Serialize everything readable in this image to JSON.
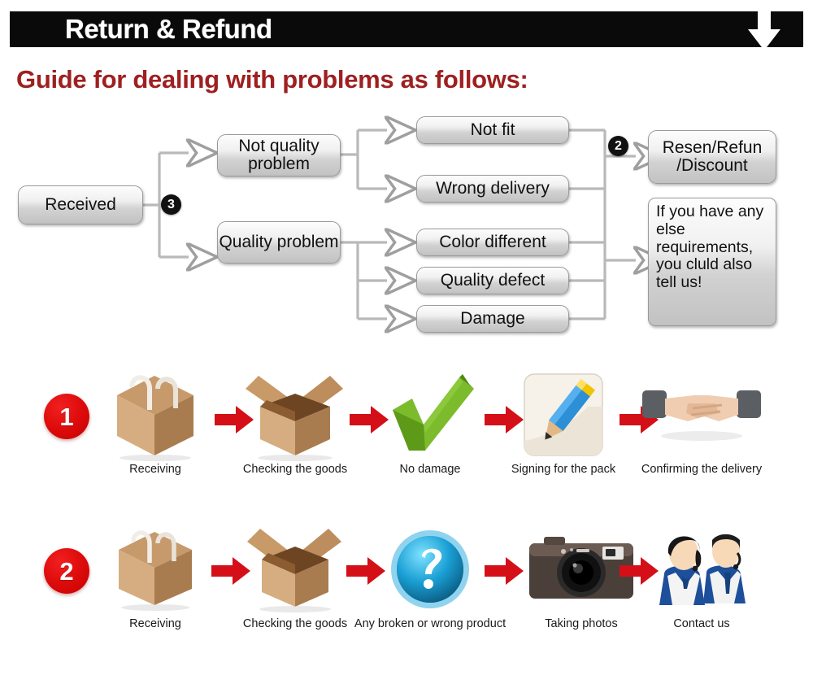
{
  "header": {
    "title": "Return & Refund",
    "arrow_icon": "down-arrow-icon"
  },
  "guide": {
    "title": "Guide for dealing with problems as follows:"
  },
  "colors": {
    "header_bg": "#0a0a0a",
    "header_text": "#ffffff",
    "guide_text": "#9e2020",
    "badge_bg": "#111111",
    "step_circle_red": "#e00d0d",
    "arrow_red": "#d40f18",
    "box_border": "#9a9a9a"
  },
  "flowchart": {
    "start": {
      "label": "Received"
    },
    "badge_3": "3",
    "badge_2": "2",
    "branches": [
      {
        "label": "Not quality problem"
      },
      {
        "label": "Quality problem"
      }
    ],
    "issues": [
      {
        "label": "Not fit"
      },
      {
        "label": "Wrong delivery"
      },
      {
        "label": "Color different"
      },
      {
        "label": "Quality defect"
      },
      {
        "label": "Damage"
      }
    ],
    "outcomes": [
      {
        "label": "Resen/Refun\n/Discount"
      },
      {
        "label": "If you have any else requirements, you cluld also tell us!"
      }
    ]
  },
  "steps": {
    "row1": {
      "number": "1",
      "cells": [
        {
          "caption": "Receiving",
          "icon": "closed-box-icon"
        },
        {
          "caption": "Checking the goods",
          "icon": "open-box-icon"
        },
        {
          "caption": "No damage",
          "icon": "green-check-icon"
        },
        {
          "caption": "Signing for the pack",
          "icon": "pencil-signing-icon"
        },
        {
          "caption": "Confirming the delivery",
          "icon": "handshake-icon"
        }
      ]
    },
    "row2": {
      "number": "2",
      "cells": [
        {
          "caption": "Receiving",
          "icon": "closed-box-icon"
        },
        {
          "caption": "Checking the goods",
          "icon": "open-box-icon"
        },
        {
          "caption": "Any broken or wrong product",
          "icon": "question-mark-icon"
        },
        {
          "caption": "Taking photos",
          "icon": "camera-icon"
        },
        {
          "caption": "Contact us",
          "icon": "support-agents-icon"
        }
      ]
    }
  }
}
